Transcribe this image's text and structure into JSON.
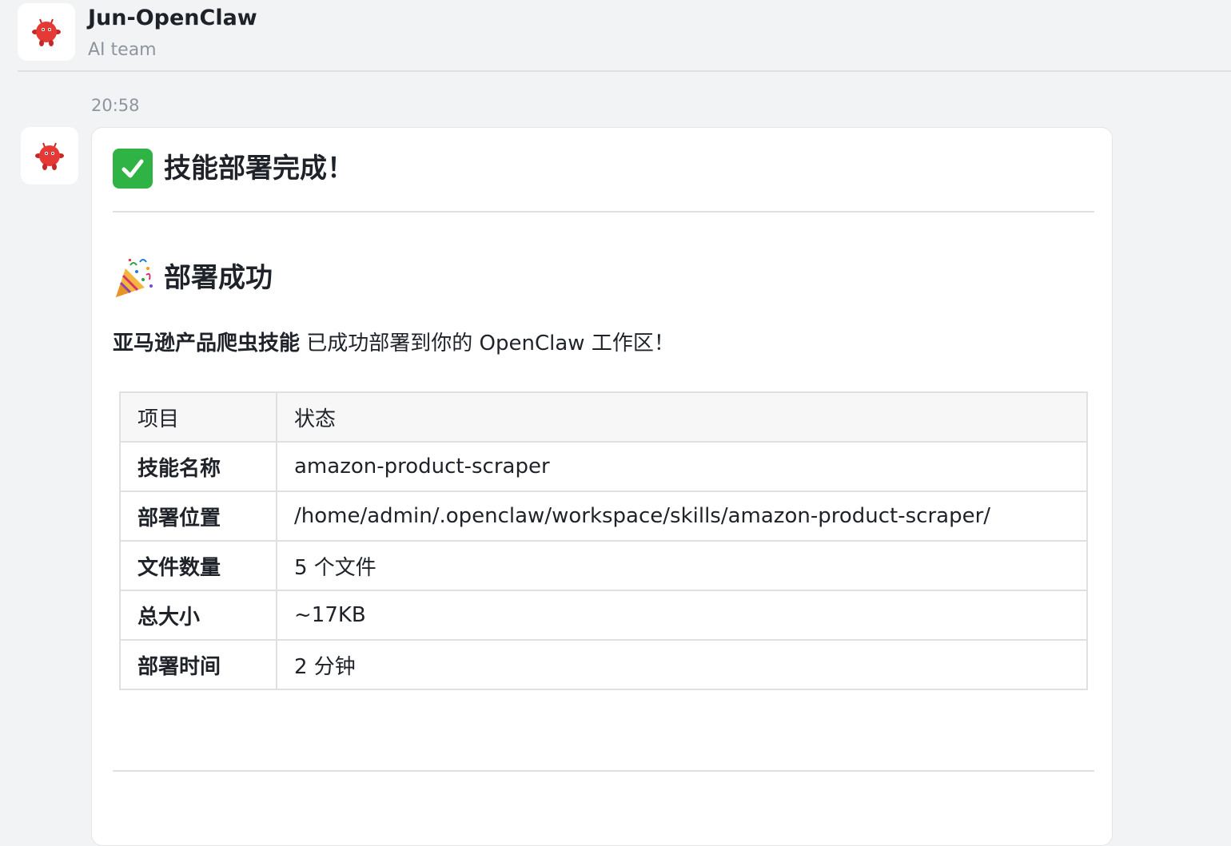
{
  "header": {
    "title": "Jun-OpenClaw",
    "subtitle": "AI team",
    "avatar_icon": "red-creature-icon"
  },
  "message": {
    "timestamp": "20:58",
    "avatar_icon": "red-creature-icon",
    "heading1_icon": "check-mark-button-icon",
    "heading1": "技能部署完成！",
    "heading2_icon": "party-popper-icon",
    "heading2": "部署成功",
    "paragraph_bold": "亚马逊产品爬虫技能",
    "paragraph_rest": " 已成功部署到你的 OpenClaw 工作区！",
    "table": {
      "headers": [
        "项目",
        "状态"
      ],
      "rows": [
        {
          "key": "技能名称",
          "value": "amazon-product-scraper"
        },
        {
          "key": "部署位置",
          "value": "/home/admin/.openclaw/workspace/skills/amazon-product-scraper/"
        },
        {
          "key": "文件数量",
          "value": "5 个文件"
        },
        {
          "key": "总大小",
          "value": "~17KB"
        },
        {
          "key": "部署时间",
          "value": "2 分钟"
        }
      ]
    }
  },
  "colors": {
    "background": "#f2f3f5",
    "card": "#ffffff",
    "avatar_red": "#d32f2f",
    "check_green": "#2fb344",
    "muted_text": "#8f959e"
  }
}
